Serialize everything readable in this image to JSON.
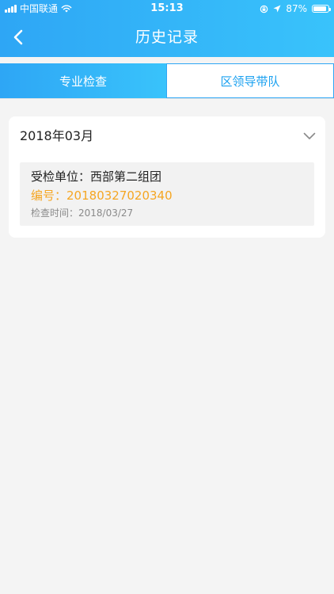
{
  "status_bar": {
    "carrier": "中国联通",
    "time": "15:13",
    "battery": "87%",
    "battery_level": 0.87,
    "icons": [
      "signal-icon",
      "wifi-icon",
      "orientation-lock-icon",
      "location-icon",
      "battery-icon"
    ]
  },
  "nav": {
    "title": "历史记录",
    "back_icon": "chevron-left-icon"
  },
  "tabs": [
    {
      "label": "专业检查",
      "active": true
    },
    {
      "label": "区领导带队",
      "active": false
    }
  ],
  "group": {
    "month": "2018年03月",
    "toggle_icon": "chevron-down-icon",
    "records": [
      {
        "unit_label": "受检单位：",
        "unit": "西部第二组团",
        "number_label": "编号：",
        "number": "20180327020340",
        "time_label": "检查时间：",
        "time": "2018/03/27"
      }
    ]
  },
  "colors": {
    "accent": "#2ea6f5",
    "accent_light": "#39c3fb",
    "number": "#f5a623",
    "background": "#f4f4f4"
  }
}
